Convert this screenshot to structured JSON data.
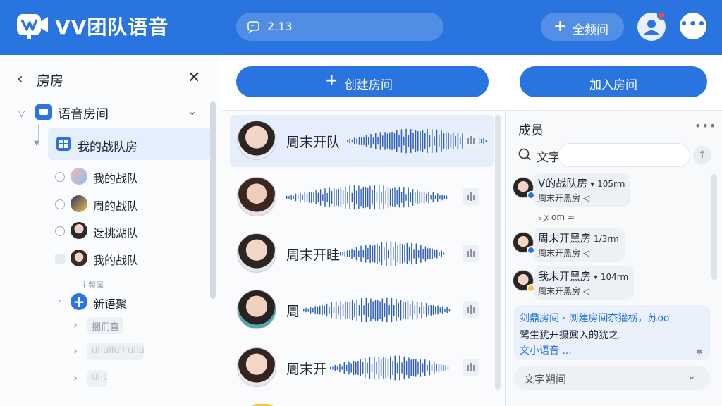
{
  "header": {
    "app_title": "VV团队语音",
    "search_value": "2.13",
    "all_rooms_label": "全频间",
    "brand_color": "#2a74e0",
    "notification_dot_color": "#f04a4a"
  },
  "sidebar": {
    "title": "房房",
    "root_label": "语音房间",
    "selected_room": "我的战队房",
    "items": [
      {
        "label": "我的战队"
      },
      {
        "label": "周的战队"
      },
      {
        "label": "迓挑湖队"
      },
      {
        "label": "我的战队"
      }
    ],
    "faded_label": "主频属",
    "new_item_label": "新语聚",
    "blurred_items": [
      "捆们盲",
      "ul·ullull·ullu",
      "ul·ull"
    ]
  },
  "toolbar": {
    "create_label": "创建房间",
    "join_label": "加入房间"
  },
  "rooms": [
    {
      "name": "周末开队",
      "active": true
    },
    {
      "name": "",
      "active": false
    },
    {
      "name": "周末开眭",
      "active": false
    },
    {
      "name": "周",
      "active": false
    },
    {
      "name": "周末开",
      "active": false
    }
  ],
  "members_panel": {
    "title": "成员",
    "search_label": "文字",
    "members": [
      {
        "name": "V的战队房",
        "meta": "▾ 105rm",
        "sub": "周末开黑房 ◁"
      },
      {
        "name": "周末开黑房",
        "meta": "1/3rm",
        "sub": "周末开黑房 ◁"
      },
      {
        "name": "我末开黑房",
        "meta": "▾ 104rm",
        "sub": "周末开黑房 ◁"
      }
    ],
    "between_note": "ₔ ꭗ om ≂",
    "notice": {
      "line1": "剑鼎房间 · 浏建房间夵獾栃，苏oo",
      "line2": "鹭生犹开摄鼐入的犹之.",
      "line3": "文小语音 ..."
    },
    "voice_select_label": "文字朔间"
  }
}
